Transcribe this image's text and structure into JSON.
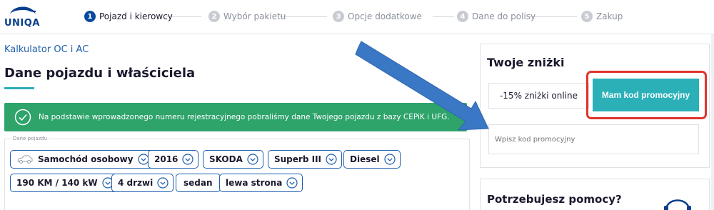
{
  "brand": {
    "name": "UNIQA"
  },
  "steps": [
    {
      "number": "1",
      "label": "Pojazd i kierowcy",
      "active": true
    },
    {
      "number": "2",
      "label": "Wybór pakietu",
      "active": false
    },
    {
      "number": "3",
      "label": "Opcje dodatkowe",
      "active": false
    },
    {
      "number": "4",
      "label": "Dane do polisy",
      "active": false
    },
    {
      "number": "5",
      "label": "Zakup",
      "active": false
    }
  ],
  "breadcrumb": "Kalkulator OC i AC",
  "page_title": "Dane pojazdu i właściciela",
  "notice": {
    "text": "Na podstawie wprowadzonego numeru rejestracyjnego pobraliśmy dane Twojego pojazdu z bazy CEPiK i UFG.",
    "icon": "check-circle-icon"
  },
  "vehicle": {
    "legend": "Dane pojazdu",
    "chips": [
      "Samochód osobowy",
      "2016",
      "SKODA",
      "Superb III",
      "Diesel",
      "190 KM / 140 kW",
      "4 drzwi",
      "sedan",
      "lewa strona"
    ]
  },
  "discounts": {
    "title": "Twoje zniżki",
    "online_label": "-15% zniżki online",
    "promo_button": "Mam kod promocyjny",
    "promo_placeholder": "Wpisz kod promocyjny"
  },
  "help": {
    "title": "Potrzebujesz pomocy?"
  },
  "colors": {
    "brand_blue": "#0a4a9e",
    "teal": "#2bb0b8",
    "success_green": "#2ea36a",
    "highlight_red": "#e0342c",
    "annotation_arrow": "#3a78c6"
  }
}
